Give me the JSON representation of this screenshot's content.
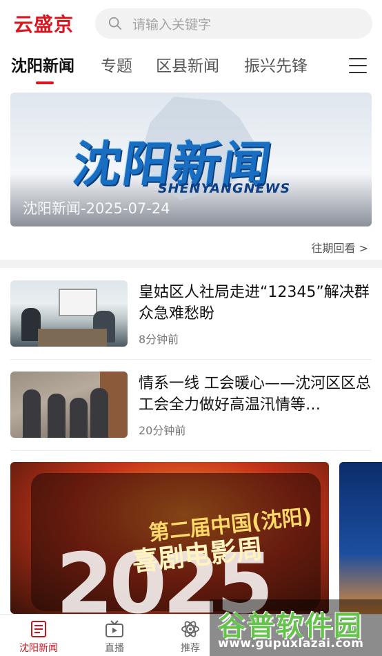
{
  "header": {
    "logo_text": "云盛京",
    "search_placeholder": "请输入关键字"
  },
  "tabs": [
    {
      "label": "沈阳新闻",
      "active": true
    },
    {
      "label": "专题",
      "active": false
    },
    {
      "label": "区县新闻",
      "active": false
    },
    {
      "label": "振兴先锋",
      "active": false
    }
  ],
  "banner": {
    "logo_cn": "沈阳新闻",
    "logo_en": "SHENYANGNEWS",
    "caption": "沈阳新闻-2025-07-24",
    "more_link": "往期回看 >"
  },
  "news": [
    {
      "title": "皇姑区人社局走进“12345”解决群众急难愁盼",
      "time": "8分钟前"
    },
    {
      "title": "情系一线 工会暖心——沈河区区总工会全力做好高温汛情等…",
      "time": "20分钟前"
    }
  ],
  "promo": {
    "line1": "第二届中国(沈阳)",
    "line2": "喜剧电影周",
    "year": "2025"
  },
  "watermark": {
    "name": "谷普软件园",
    "url": "www.gupuxlazai.com"
  },
  "bottom_nav": [
    {
      "label": "沈阳新闻",
      "icon": "news-icon",
      "active": true
    },
    {
      "label": "直播",
      "icon": "tv-icon",
      "active": false
    },
    {
      "label": "推荐",
      "icon": "atom-icon",
      "active": false
    }
  ],
  "colors": {
    "brand_red": "#d7161f",
    "watermark_green": "#63c34a"
  }
}
